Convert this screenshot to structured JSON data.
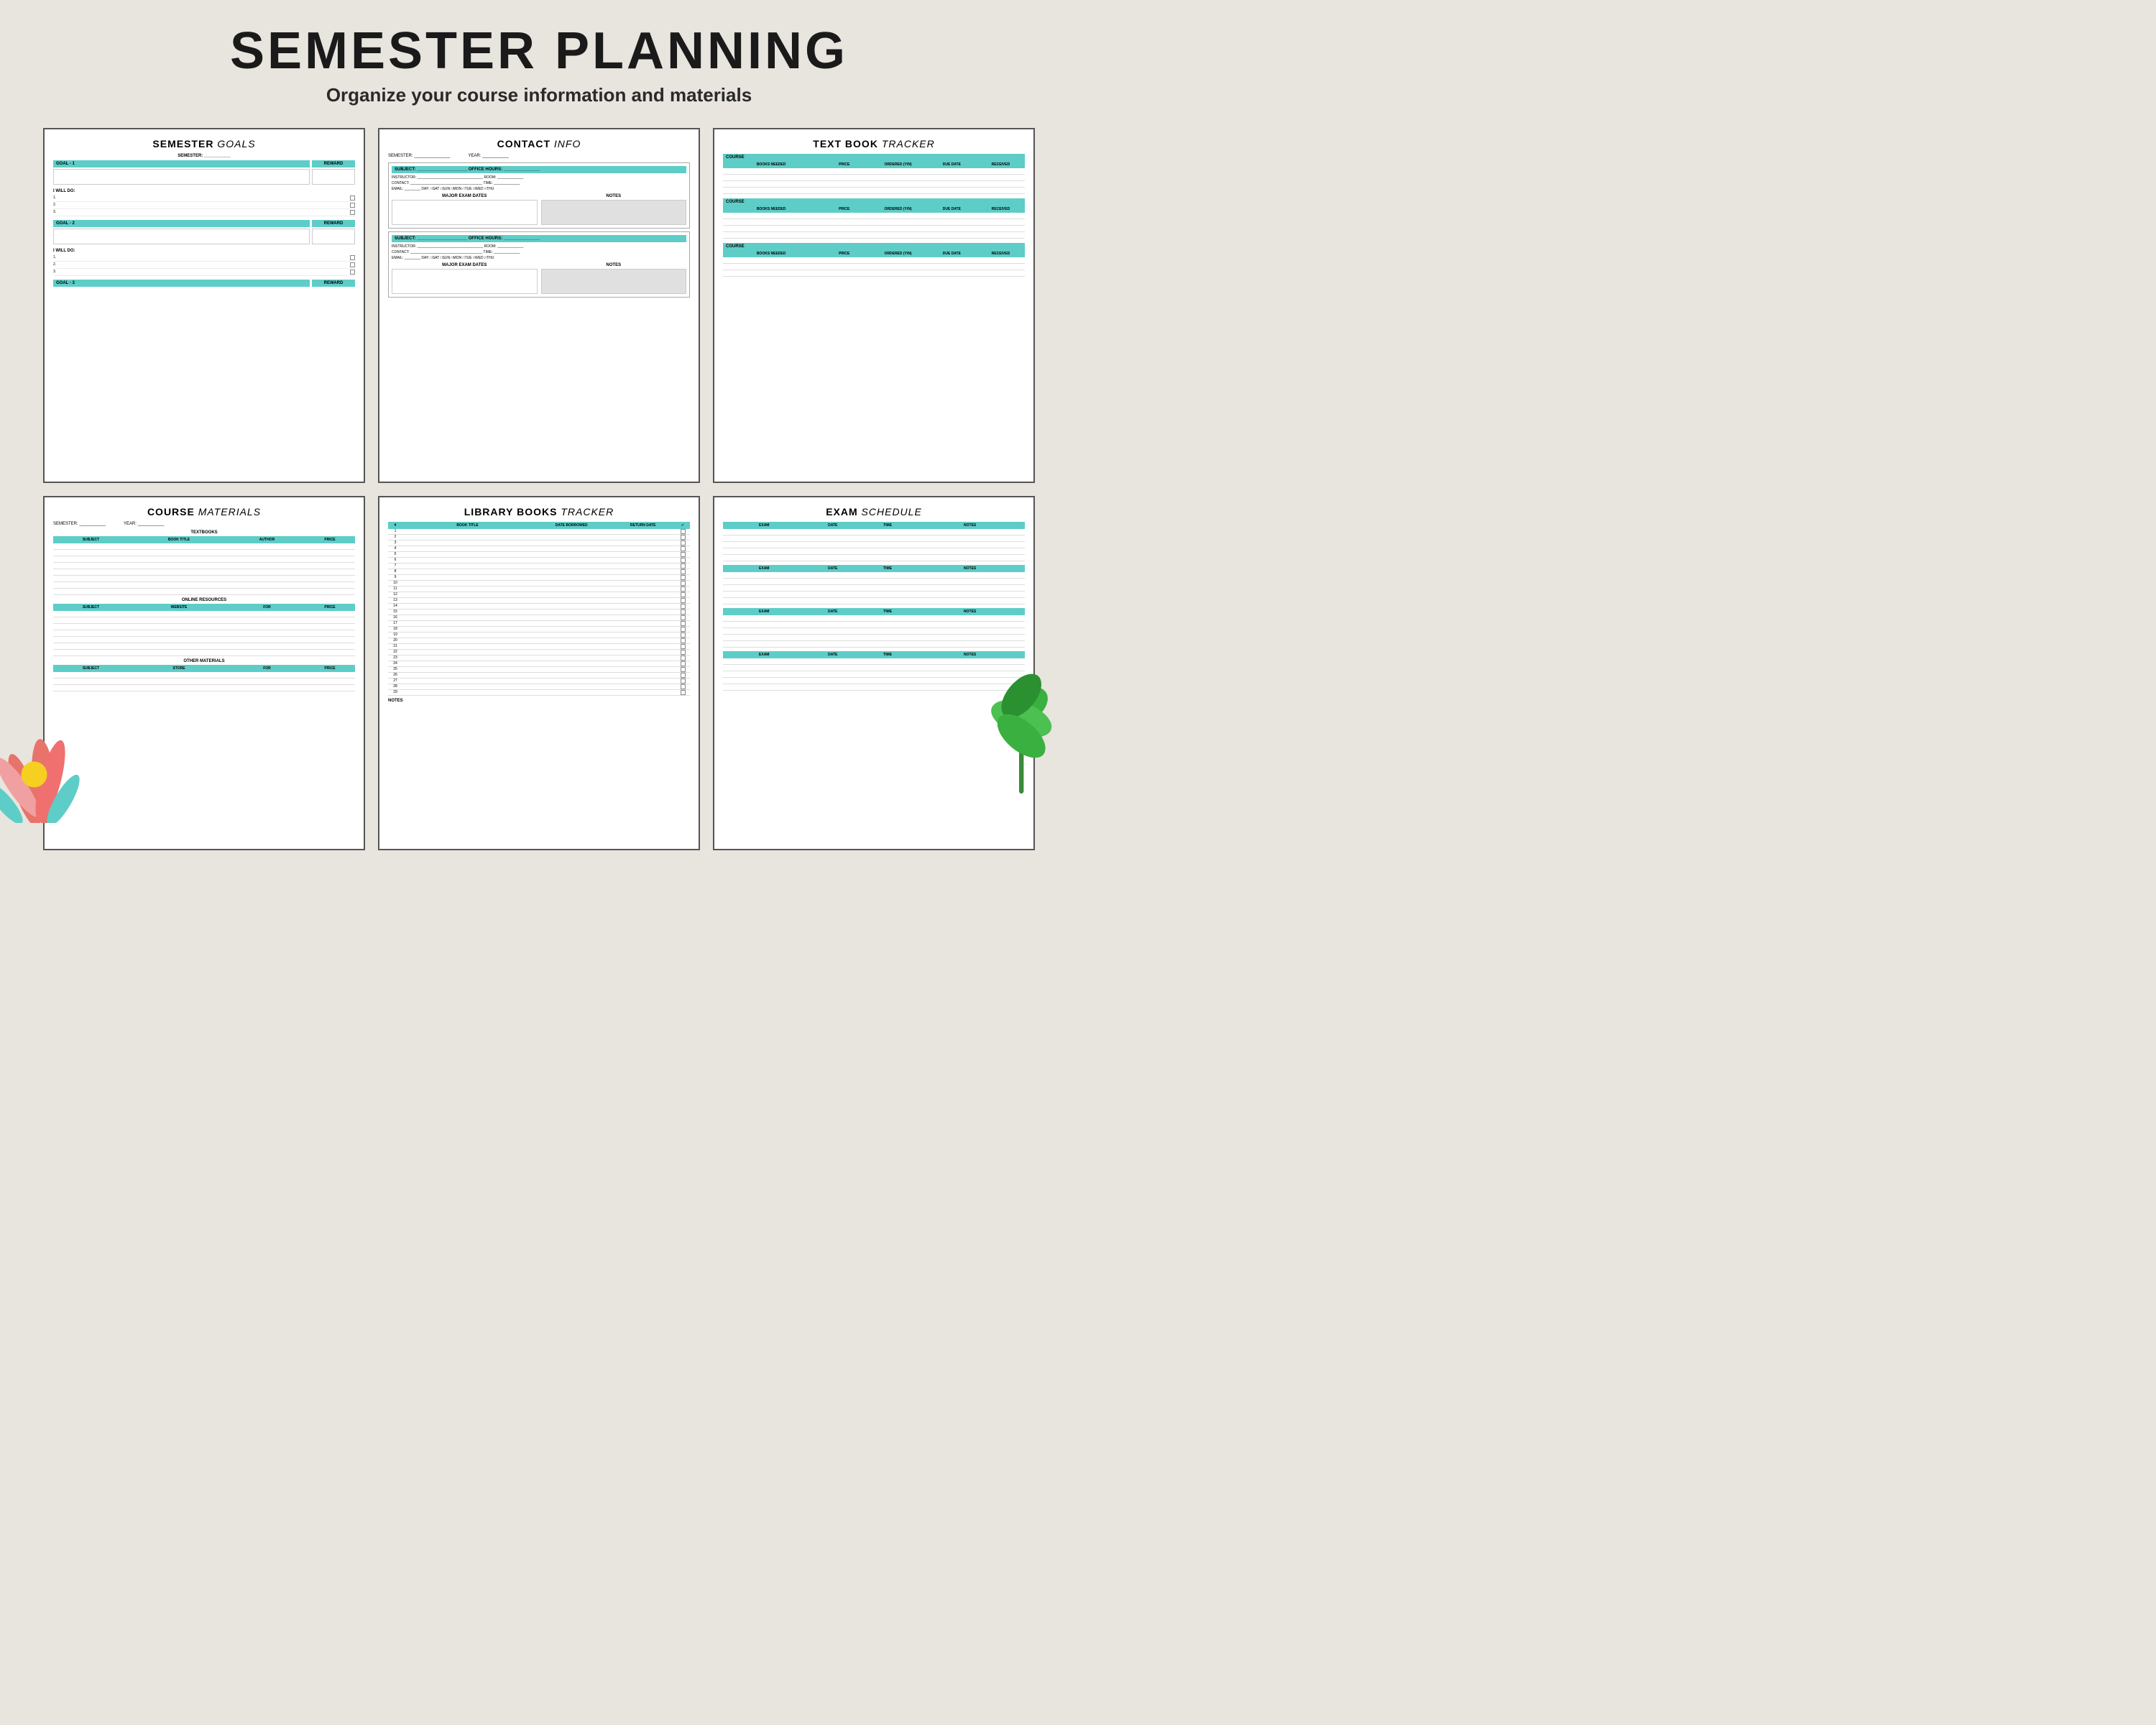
{
  "header": {
    "title": "SEMESTER PLANNING",
    "subtitle": "Organize your course information and materials"
  },
  "colors": {
    "teal": "#5ecdc8",
    "border": "#555555",
    "bg": "#e8e4de"
  },
  "cards": {
    "goals": {
      "title_bold": "SEMESTER",
      "title_italic": "GOALS",
      "semester_label": "SEMESTER:",
      "goals": [
        {
          "label": "GOAL - 1",
          "reward": "REWARD"
        },
        {
          "label": "GOAL - 2",
          "reward": "REWARD"
        },
        {
          "label": "GOAL - 3",
          "reward": "REWARD"
        }
      ],
      "will_do_label": "I WILL DO:",
      "will_do_items": [
        "1.",
        "2.",
        "3."
      ]
    },
    "contact": {
      "title_bold": "CONTACT",
      "title_italic": "INFO",
      "semester_label": "SEMESTER:",
      "year_label": "YEAR:",
      "fields": [
        "SUBJECT:",
        "INSTRUCTOR:",
        "CONTACT:",
        "EMAIL:"
      ],
      "right_fields": [
        "OFFICE HOURS:",
        "ROOM:",
        "TIME:"
      ],
      "day_label": "DAY:",
      "days": [
        "SAT",
        "SUN",
        "MON",
        "TUE",
        "WED",
        "THU"
      ],
      "exam_dates_label": "MAJOR EXAM DATES",
      "notes_label": "NOTES"
    },
    "textbook": {
      "title_bold": "TEXT BOOK",
      "title_italic": "TRACKER",
      "course_label": "COURSE",
      "columns": [
        "BOOKS NEEDED",
        "PRICE",
        "ORDERED (Y/N)",
        "DUE DATE",
        "RECEIVED"
      ],
      "rows_per_section": 4,
      "sections": 3
    },
    "course_materials": {
      "title_bold": "COURSE",
      "title_italic": "MATERIALS",
      "semester_label": "SEMESTER:",
      "year_label": "YEAR:",
      "textbooks_label": "TEXTBOOKS",
      "textbook_cols": [
        "SUBJECT",
        "BOOK TITLE",
        "AUTHOR",
        "PRICE"
      ],
      "online_label": "ONLINE RESOURCES",
      "online_cols": [
        "SUBJECT",
        "WEBSITE",
        "FOR",
        "PRICE"
      ],
      "other_label": "OTHER MATERIALS",
      "other_cols": [
        "SUBJECT",
        "STORE",
        "FOR",
        "PRICE"
      ]
    },
    "library": {
      "title_bold": "LIBRARY BOOKS",
      "title_italic": "TRACKER",
      "columns": [
        "#",
        "BOOK TITLE",
        "DATE BORROWED",
        "RETURN DATE",
        "✓"
      ],
      "rows": 29,
      "notes_label": "NOTES"
    },
    "exam": {
      "title_bold": "EXAM",
      "title_italic": "SCHEDULE",
      "columns": [
        "EXAM",
        "DATE",
        "TIME",
        "NOTES"
      ],
      "sections": 4,
      "rows_per_section": 5
    }
  }
}
